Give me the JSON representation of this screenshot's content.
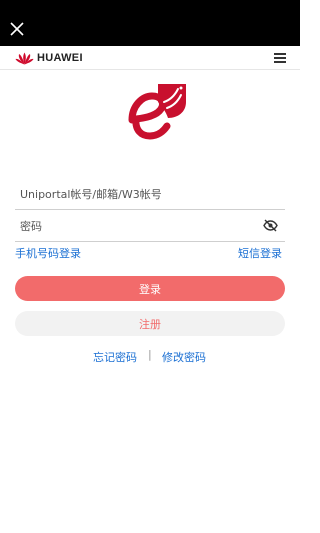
{
  "brand": {
    "name": "HUAWEI",
    "accent": "#cf0a2c"
  },
  "form": {
    "account_placeholder": "Uniportal帐号/邮箱/W3帐号",
    "password_placeholder": "密码"
  },
  "links": {
    "phone_login": "手机号码登录",
    "sms_login": "短信登录",
    "forgot_password": "忘记密码",
    "separator": "|",
    "change_password": "修改密码"
  },
  "buttons": {
    "login": "登录",
    "register": "注册"
  },
  "colors": {
    "topbar": "#000000",
    "primary": "#f26b6b",
    "link": "#1a6fd3",
    "logo_red": "#c8102e"
  },
  "icons": {
    "close": "close-icon",
    "menu": "menu-icon",
    "eye": "eye-off-icon",
    "app_logo": "app-logo-e-icon"
  }
}
